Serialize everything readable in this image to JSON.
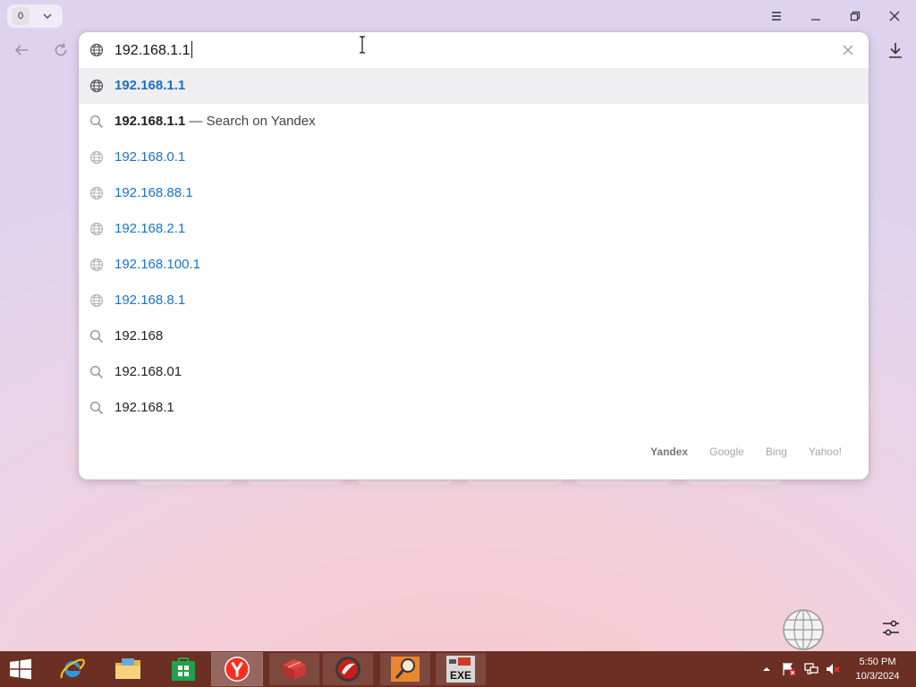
{
  "titlebar": {
    "tab_count": "0"
  },
  "omnibox": {
    "input_value": "192.168.1.1"
  },
  "suggestions": [
    {
      "type": "url",
      "text": "192.168.1.1",
      "tail": "",
      "bold": true,
      "selected": true
    },
    {
      "type": "search",
      "text": "192.168.1.1",
      "tail": " — Search on Yandex",
      "bold": true,
      "selected": false
    },
    {
      "type": "url",
      "text": "192.168.0.1",
      "tail": "",
      "bold": false,
      "selected": false
    },
    {
      "type": "url",
      "text": "192.168.88.1",
      "tail": "",
      "bold": false,
      "selected": false
    },
    {
      "type": "url",
      "text": "192.168.2.1",
      "tail": "",
      "bold": false,
      "selected": false
    },
    {
      "type": "url",
      "text": "192.168.100.1",
      "tail": "",
      "bold": false,
      "selected": false
    },
    {
      "type": "url",
      "text": "192.168.8.1",
      "tail": "",
      "bold": false,
      "selected": false
    },
    {
      "type": "search",
      "text": "192.168",
      "tail": "",
      "bold": false,
      "selected": false
    },
    {
      "type": "search",
      "text": "192.168.01",
      "tail": "",
      "bold": false,
      "selected": false
    },
    {
      "type": "search",
      "text": "192.168.1",
      "tail": "",
      "bold": false,
      "selected": false
    }
  ],
  "search_engines": [
    {
      "name": "Yandex",
      "active": true
    },
    {
      "name": "Google",
      "active": false
    },
    {
      "name": "Bing",
      "active": false
    },
    {
      "name": "Yahoo!",
      "active": false
    }
  ],
  "taskbar": {
    "apps": [
      {
        "name": "internet-explorer",
        "icon": "ie-icon"
      },
      {
        "name": "file-explorer",
        "icon": "folder-icon"
      },
      {
        "name": "store",
        "icon": "store-icon"
      },
      {
        "name": "yandex-browser",
        "icon": "yandex-icon"
      },
      {
        "name": "app-red-box",
        "icon": "red-box-icon"
      },
      {
        "name": "app-red-disc",
        "icon": "red-disc-icon"
      },
      {
        "name": "app-search-tool",
        "icon": "magnifier-icon"
      },
      {
        "name": "app-exe",
        "icon": "exe-icon"
      }
    ],
    "exe_label": "EXE",
    "clock_time": "5:50 PM",
    "clock_date": "10/3/2024"
  },
  "colors": {
    "taskbar": "#6b2f24",
    "link_blue": "#1a73c8",
    "selected_row": "#efeff1"
  }
}
